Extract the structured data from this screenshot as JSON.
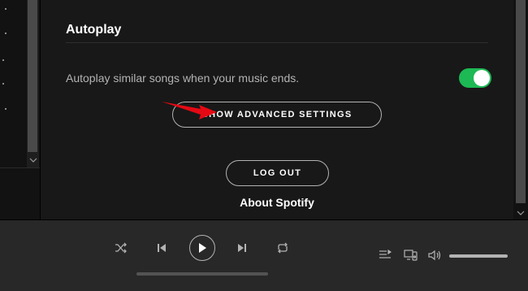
{
  "autoplay": {
    "title": "Autoplay",
    "description": "Autoplay similar songs when your music ends.",
    "enabled": true
  },
  "buttons": {
    "advanced_settings": "SHOW ADVANCED SETTINGS",
    "logout": "LOG OUT"
  },
  "links": {
    "about": "About Spotify"
  },
  "colors": {
    "accent": "#1db954",
    "annotation_arrow": "#e50914",
    "background": "#181818",
    "player_bar": "#282828"
  },
  "player": {
    "controls": [
      "shuffle-icon",
      "previous-icon",
      "play-icon",
      "next-icon",
      "repeat-icon"
    ],
    "right_controls": [
      "queue-icon",
      "devices-icon",
      "volume-icon"
    ],
    "volume_level": 1.0,
    "progress": 0
  }
}
